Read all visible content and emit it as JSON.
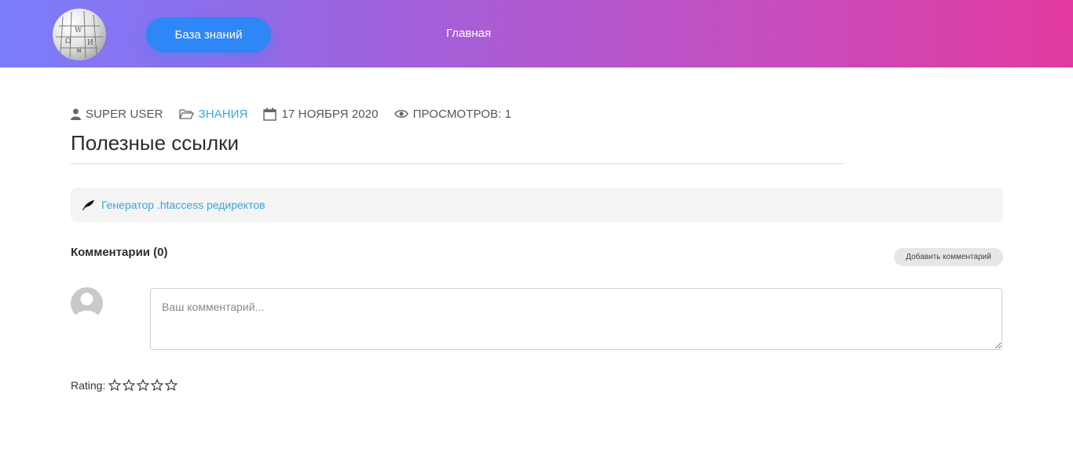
{
  "header": {
    "logo_icon": "wikipedia-globe-icon",
    "nav": {
      "active_label": "База знаний",
      "home_label": "Главная"
    },
    "gradient": [
      "#7b7dfb",
      "#e23a9e"
    ],
    "accent": "#2f86f6"
  },
  "article": {
    "meta": {
      "author": "SUPER USER",
      "category": "ЗНАНИЯ",
      "date": "17 НОЯБРЯ 2020",
      "views": "ПРОСМОТРОВ: 1"
    },
    "title": "Полезные ссылки",
    "links": [
      {
        "label": "Генератор .htaccess редиректов",
        "icon": "feather-icon"
      }
    ]
  },
  "comments": {
    "title": "Комментарии (0)",
    "add_label": "Добавить комментарий",
    "placeholder": "Ваш комментарий..."
  },
  "rating": {
    "label": "Rating:",
    "stars_max": 5,
    "stars_value": 0
  },
  "colors": {
    "link": "#3aa6d6",
    "text": "#2c2c2c"
  }
}
